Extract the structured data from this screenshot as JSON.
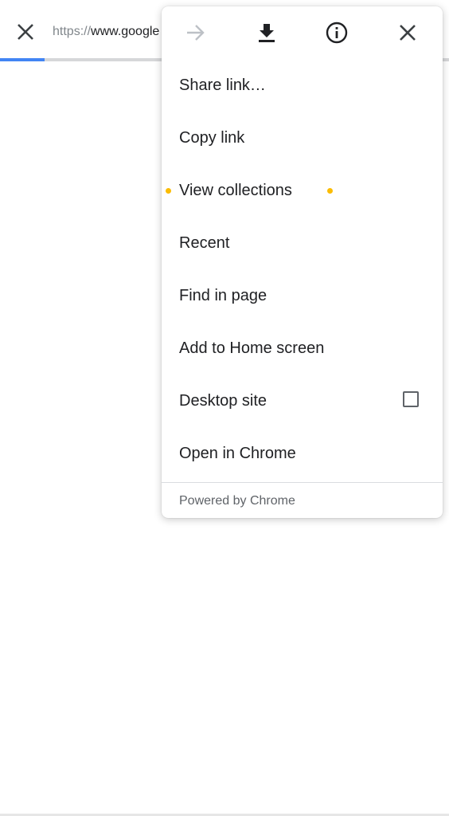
{
  "toolbar": {
    "close_icon": "close-icon",
    "url_scheme": "https://",
    "url_host": "www.google",
    "progress_fraction": 0.1,
    "accent_color": "#4285f4"
  },
  "menu": {
    "icons": [
      {
        "name": "forward-icon",
        "enabled": false
      },
      {
        "name": "download-icon",
        "enabled": true
      },
      {
        "name": "info-icon",
        "enabled": true
      },
      {
        "name": "close-icon",
        "enabled": true
      }
    ],
    "items": [
      {
        "label": "Share link…"
      },
      {
        "label": "Copy link"
      },
      {
        "label": "View collections",
        "highlight_dots": true,
        "dot_color": "#fbbc04"
      },
      {
        "label": "Recent"
      },
      {
        "label": "Find in page"
      },
      {
        "label": "Add to Home screen"
      },
      {
        "label": "Desktop site",
        "checkbox": true,
        "checked": false
      },
      {
        "label": "Open in Chrome"
      }
    ],
    "footer": "Powered by Chrome"
  }
}
